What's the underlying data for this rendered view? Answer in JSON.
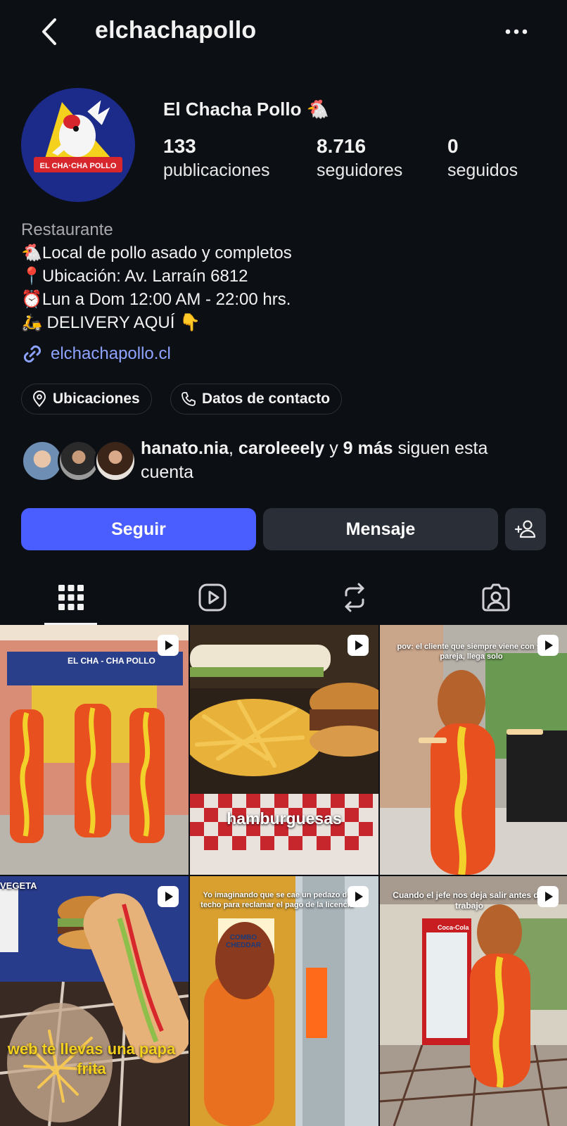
{
  "header": {
    "username": "elchachapollo"
  },
  "profile": {
    "display_name": "El Chacha Pollo 🐔",
    "avatar_text": "EL CHA·CHA POLLO",
    "stats": [
      {
        "value": "133",
        "label": "publicaciones"
      },
      {
        "value": "8.716",
        "label": "seguidores"
      },
      {
        "value": "0",
        "label": "seguidos"
      }
    ]
  },
  "bio": {
    "category": "Restaurante",
    "lines": [
      "🐔Local de pollo asado y completos",
      "📍Ubicación: Av. Larraín 6812",
      "⏰Lun a Dom 12:00 AM - 22:00 hrs.",
      "🛵 DELIVERY AQUÍ 👇"
    ],
    "link": "elchachapollo.cl"
  },
  "chips": {
    "locations": "Ubicaciones",
    "contact": "Datos de contacto"
  },
  "followed_by": {
    "name1": "hanato.nia",
    "sep": ", ",
    "name2": "caroleeely",
    "conj": " y ",
    "more": "9 más",
    "suffix": " siguen esta cuenta"
  },
  "actions": {
    "follow": "Seguir",
    "message": "Mensaje"
  },
  "tabs": [
    "grid-icon",
    "reels-icon",
    "reposts-icon",
    "tagged-icon"
  ],
  "posts": [
    {
      "overlay": "",
      "sign": "EL CHA - CHA POLLO"
    },
    {
      "overlay": "hamburguesas"
    },
    {
      "overlay": "pov: el cliente que siempre viene con su pareja, llega solo"
    },
    {
      "overlay": "web te llevas una papa frita",
      "sign": "VEGETA"
    },
    {
      "overlay": "Yo imaginando que se cae un pedazo de techo para reclamar el pago de la licencia",
      "sign": "COMBO CHEDDAR"
    },
    {
      "overlay": "Cuando el jefe nos deja salir antes del trabajo",
      "sign": "Coca-Cola"
    }
  ],
  "colors": {
    "background": "#0c0f14",
    "follow_button": "#4a5dff",
    "secondary_button": "#2a2e36",
    "link": "#8ea3ff"
  }
}
